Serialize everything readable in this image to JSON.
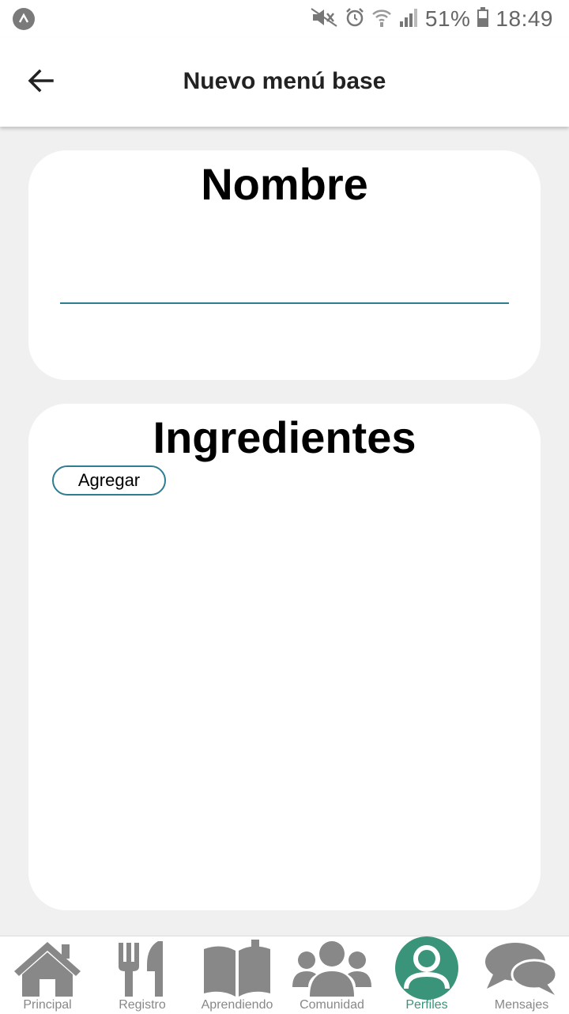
{
  "status_bar": {
    "battery": "51%",
    "time": "18:49"
  },
  "header": {
    "title": "Nuevo menú base",
    "back_icon": "arrow-left-icon"
  },
  "name_card": {
    "title": "Nombre",
    "input_value": "",
    "underline_color": "#2e7d91"
  },
  "ingredients_card": {
    "title": "Ingredientes",
    "add_label": "Agregar"
  },
  "bottom_nav": {
    "active_color": "#3a9479",
    "inactive_color": "#888888",
    "items": [
      {
        "label": "Principal",
        "icon": "home-icon"
      },
      {
        "label": "Registro",
        "icon": "fork-knife-icon"
      },
      {
        "label": "Aprendiendo",
        "icon": "book-icon"
      },
      {
        "label": "Comunidad",
        "icon": "users-icon"
      },
      {
        "label": "Perfiles",
        "icon": "profile-icon",
        "active": true
      },
      {
        "label": "Mensajes",
        "icon": "chat-icon"
      }
    ]
  }
}
